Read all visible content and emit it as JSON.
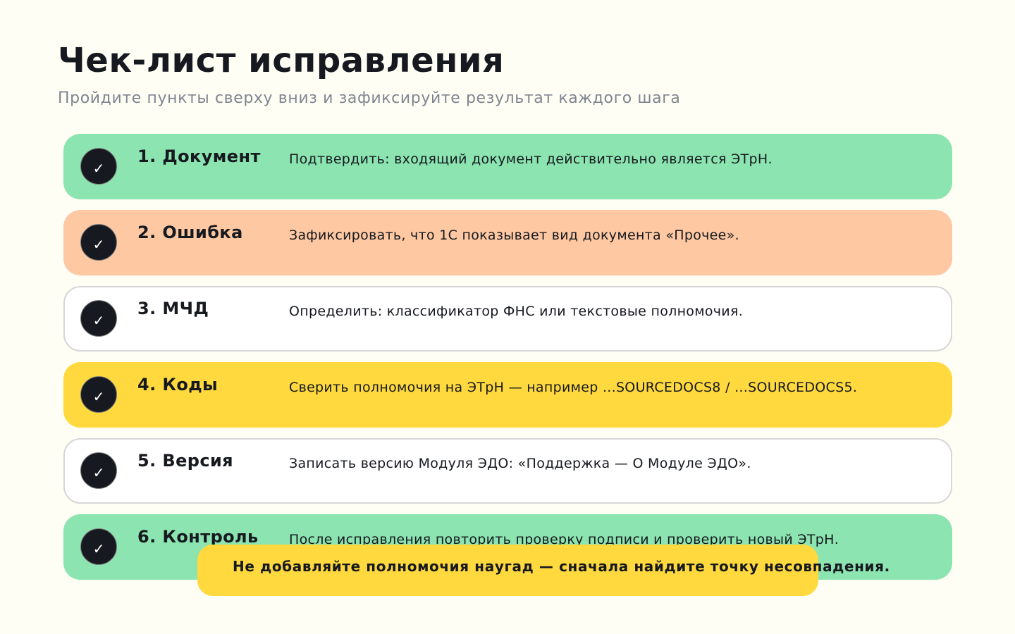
{
  "page": {
    "title": "Чек-лист исправления",
    "subtitle": "Пройдите пункты сверху вниз и зафиксируйте результат каждого шага"
  },
  "checklist": {
    "check_glyph": "✓",
    "items": [
      {
        "title": "1. Документ",
        "text": "Подтвердить: входящий документ действительно является ЭТрН.",
        "color": "#8ce4b0"
      },
      {
        "title": "2. Ошибка",
        "text": "Зафиксировать, что 1С показывает вид документа «Прочее».",
        "color": "#fec8a2"
      },
      {
        "title": "3. МЧД",
        "text": "Определить: классификатор ФНС или текстовые полномочия.",
        "color": "#ffffff"
      },
      {
        "title": "4. Коды",
        "text": "Сверить полномочия на ЭТрН — например ...SOURCEDOCS8 / ...SOURCEDOCS5.",
        "color": "#ffd93d"
      },
      {
        "title": "5. Версия",
        "text": "Записать версию Модуля ЭДО: «Поддержка — О Модуле ЭДО».",
        "color": "#ffffff"
      },
      {
        "title": "6. Контроль",
        "text": "После исправления повторить проверку подписи и проверить новый ЭТрН.",
        "color": "#8ce4b0"
      }
    ]
  },
  "warning": {
    "text": "Не добавляйте полномочия наугад — сначала найдите точку несовпадения.",
    "color": "#ffd93d"
  }
}
